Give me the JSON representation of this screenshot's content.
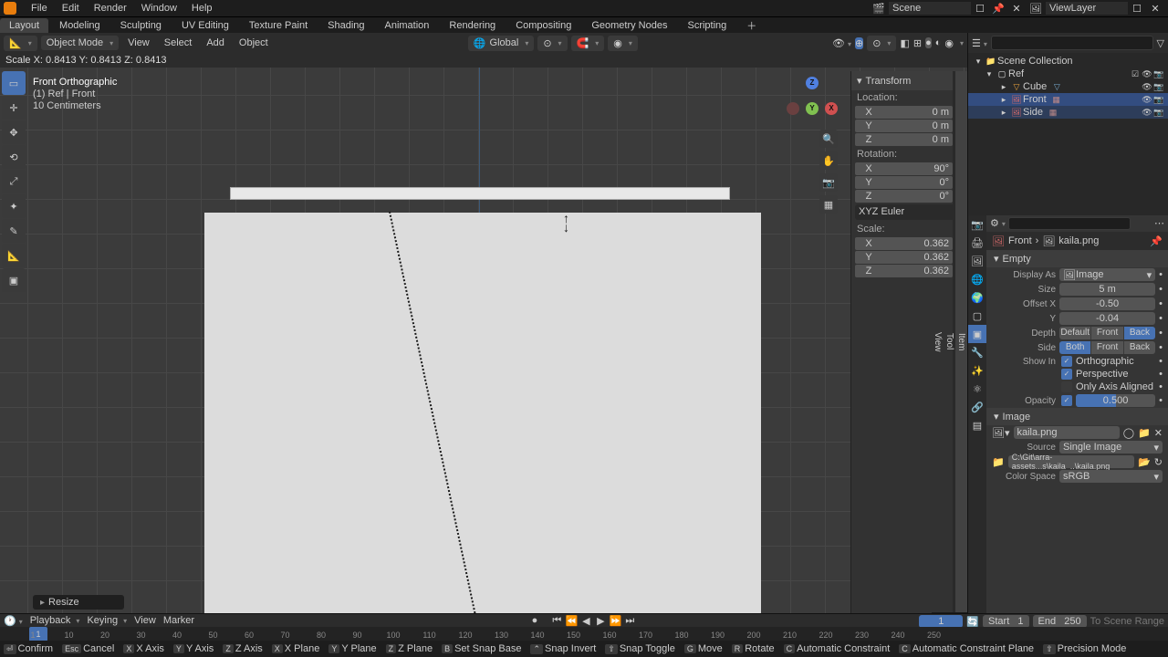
{
  "topmenu": [
    "File",
    "Edit",
    "Render",
    "Window",
    "Help"
  ],
  "workspaces": [
    "Layout",
    "Modeling",
    "Sculpting",
    "UV Editing",
    "Texture Paint",
    "Shading",
    "Animation",
    "Rendering",
    "Compositing",
    "Geometry Nodes",
    "Scripting"
  ],
  "scene_label": "Scene",
  "viewlayer_label": "ViewLayer",
  "vp": {
    "mode": "Object Mode",
    "menus": [
      "View",
      "Select",
      "Add",
      "Object"
    ],
    "orient": "Global",
    "status": "Scale X: 0.8413   Y: 0.8413   Z: 0.8413",
    "info_title": "Front Orthographic",
    "info_sub": "(1) Ref | Front",
    "info_scale": "10 Centimeters",
    "hint": "Resize"
  },
  "transform": {
    "title": "Transform",
    "loc_label": "Location:",
    "loc": [
      {
        "a": "X",
        "v": "0 m"
      },
      {
        "a": "Y",
        "v": "0 m"
      },
      {
        "a": "Z",
        "v": "0 m"
      }
    ],
    "rot_label": "Rotation:",
    "rot": [
      {
        "a": "X",
        "v": "90°"
      },
      {
        "a": "Y",
        "v": "0°"
      },
      {
        "a": "Z",
        "v": "0°"
      }
    ],
    "rotmode": "XYZ Euler",
    "scale_label": "Scale:",
    "scale": [
      {
        "a": "X",
        "v": "0.362"
      },
      {
        "a": "Y",
        "v": "0.362"
      },
      {
        "a": "Z",
        "v": "0.362"
      }
    ],
    "tabs": [
      "Item",
      "Tool",
      "View"
    ]
  },
  "outliner": {
    "root": "Scene Collection",
    "coll": "Ref",
    "items": [
      {
        "name": "Cube",
        "sel": false,
        "color": "#e8a23c"
      },
      {
        "name": "Front",
        "sel": true,
        "color": "#d46a6a"
      },
      {
        "name": "Side",
        "sel": false,
        "color": "#d46a6a"
      }
    ]
  },
  "props": {
    "breadcrumb_obj": "Front",
    "breadcrumb_data": "kaila.png",
    "empty_h": "Empty",
    "display_as_lbl": "Display As",
    "display_as": "Image",
    "size_lbl": "Size",
    "size": "5 m",
    "offx_lbl": "Offset X",
    "offx": "-0.50",
    "offy_lbl": "Y",
    "offy": "-0.04",
    "depth_lbl": "Depth",
    "depth_opts": [
      "Default",
      "Front",
      "Back"
    ],
    "depth_active": 2,
    "side_lbl": "Side",
    "side_opts": [
      "Both",
      "Front",
      "Back"
    ],
    "side_active": 0,
    "showin_lbl": "Show In",
    "show_ortho": "Orthographic",
    "show_persp": "Perspective",
    "show_axis": "Only Axis Aligned",
    "opacity_lbl": "Opacity",
    "opacity": "0.500",
    "image_h": "Image",
    "image_name": "kaila.png",
    "source_lbl": "Source",
    "source": "Single Image",
    "filepath": "C:\\Git\\arra-assets...s\\kaila_..\\kaila.png",
    "colorspace_lbl": "Color Space",
    "colorspace": "sRGB"
  },
  "timeline": {
    "menus": [
      "Playback",
      "Keying",
      "View",
      "Marker"
    ],
    "current": "1",
    "start_lbl": "Start",
    "start": "1",
    "end_lbl": "End",
    "end": "250",
    "autorange": "To Scene Range",
    "ticks": [
      "1",
      "10",
      "20",
      "30",
      "40",
      "50",
      "60",
      "70",
      "80",
      "90",
      "100",
      "110",
      "120",
      "130",
      "140",
      "150",
      "160",
      "170",
      "180",
      "190",
      "200",
      "210",
      "220",
      "230",
      "240",
      "250"
    ]
  },
  "status": [
    {
      "k": "⏎",
      "t": "Confirm"
    },
    {
      "k": "Esc",
      "t": "Cancel"
    },
    {
      "k": "X",
      "t": "X Axis"
    },
    {
      "k": "Y",
      "t": "Y Axis"
    },
    {
      "k": "Z",
      "t": "Z Axis"
    },
    {
      "k": "X",
      "t": "X Plane"
    },
    {
      "k": "Y",
      "t": "Y Plane"
    },
    {
      "k": "Z",
      "t": "Z Plane"
    },
    {
      "k": "B",
      "t": "Set Snap Base"
    },
    {
      "k": "⌃",
      "t": "Snap Invert"
    },
    {
      "k": "⇧",
      "t": "Snap Toggle"
    },
    {
      "k": "G",
      "t": "Move"
    },
    {
      "k": "R",
      "t": "Rotate"
    },
    {
      "k": "C",
      "t": "Automatic Constraint"
    },
    {
      "k": "C",
      "t": "Automatic Constraint Plane"
    },
    {
      "k": "⇧",
      "t": "Precision Mode"
    }
  ]
}
